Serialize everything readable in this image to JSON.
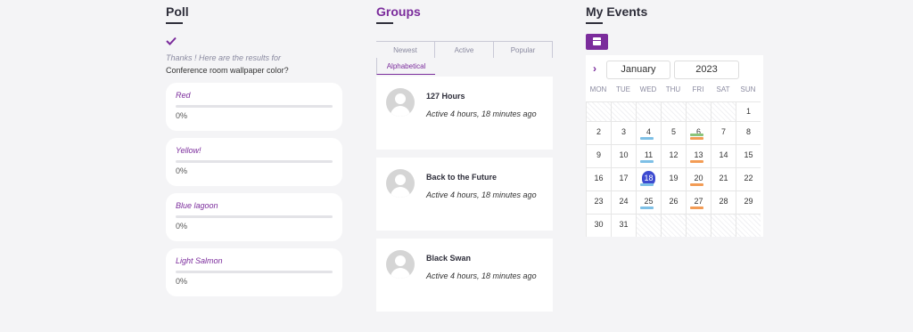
{
  "poll": {
    "title": "Poll",
    "thanks": "Thanks ! Here are the results for",
    "question": "Conference room wallpaper color?",
    "options": [
      {
        "label": "Red",
        "percent": "0%",
        "value": 0
      },
      {
        "label": "Yellow!",
        "percent": "0%",
        "value": 0
      },
      {
        "label": "Blue lagoon",
        "percent": "0%",
        "value": 0
      },
      {
        "label": "Light Salmon",
        "percent": "0%",
        "value": 0
      }
    ]
  },
  "groups": {
    "title": "Groups",
    "tabs": [
      "Newest",
      "Active",
      "Popular",
      "Alphabetical"
    ],
    "active_tab": "Alphabetical",
    "items": [
      {
        "name": "127 Hours",
        "meta": "Active 4 hours, 18 minutes ago"
      },
      {
        "name": "Back to the Future",
        "meta": "Active 4 hours, 18 minutes ago"
      },
      {
        "name": "Black Swan",
        "meta": "Active 4 hours, 18 minutes ago"
      }
    ]
  },
  "events": {
    "title": "My Events",
    "calendar_icon": "calendar-icon",
    "month": "January",
    "year": "2023",
    "weekdays": [
      "MON",
      "TUE",
      "WED",
      "THU",
      "FRI",
      "SAT",
      "SUN"
    ],
    "today": "18",
    "days": [
      "",
      "",
      "",
      "",
      "",
      "",
      "1",
      "2",
      "3",
      "4",
      "5",
      "6",
      "7",
      "8",
      "9",
      "10",
      "11",
      "12",
      "13",
      "14",
      "15",
      "16",
      "17",
      "18",
      "19",
      "20",
      "21",
      "22",
      "23",
      "24",
      "25",
      "26",
      "27",
      "28",
      "29",
      "30",
      "31"
    ],
    "event_markers": {
      "4": [
        "blue"
      ],
      "6": [
        "green",
        "orange"
      ],
      "11": [
        "blue"
      ],
      "13": [
        "orange"
      ],
      "18": [
        "blue"
      ],
      "20": [
        "orange"
      ],
      "25": [
        "blue"
      ],
      "27": [
        "orange"
      ]
    },
    "colors": {
      "accent": "#7b2c9c",
      "today": "#3c4ad0",
      "blue": "#7ec0e6",
      "orange": "#f39c55",
      "green": "#8bc47a"
    }
  }
}
